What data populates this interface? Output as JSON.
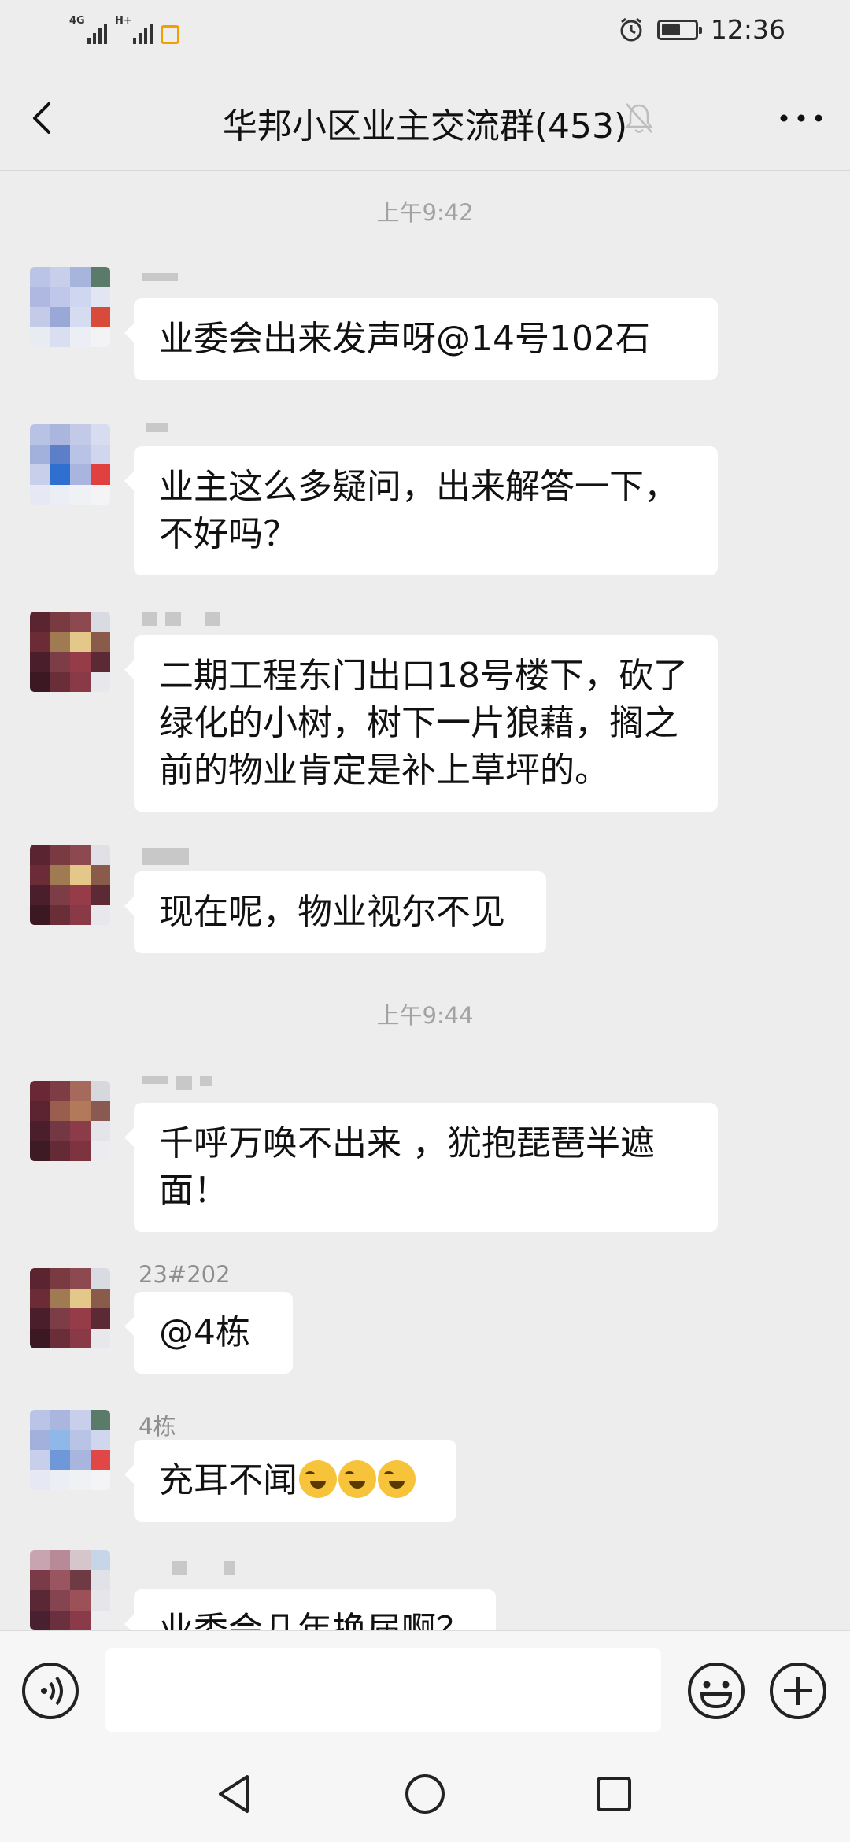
{
  "status_bar": {
    "network_1": "4G",
    "network_2": "H+",
    "time": "12:36"
  },
  "header": {
    "title": "华邦小区业主交流群(453)",
    "back_icon": "chevron-left-icon",
    "mute_icon": "bell-off-icon",
    "more_icon": "more-icon"
  },
  "chat": {
    "timestamps": [
      "上午9:42",
      "上午9:44"
    ],
    "messages": [
      {
        "sender": "",
        "text": "业委会出来发声呀@14号102石"
      },
      {
        "sender": "",
        "text": "业主这么多疑问，出来解答一下，不好吗？"
      },
      {
        "sender": "",
        "text": "二期工程东门出口18号楼下，砍了绿化的小树，树下一片狼藉，搁之前的物业肯定是补上草坪的。"
      },
      {
        "sender": "",
        "text": "现在呢，物业视尔不见"
      },
      {
        "sender": "",
        "text": "千呼万唤不出来 ，犹抱琵琶半遮面！"
      },
      {
        "sender": "23#202",
        "text": "@4栋"
      },
      {
        "sender": "4栋",
        "text": "充耳不闻"
      },
      {
        "sender": "",
        "text": "业委会几年换届啊？"
      }
    ]
  },
  "input_bar": {
    "voice_icon": "voice-icon",
    "emoji_icon": "emoji-icon",
    "plus_icon": "plus-icon",
    "placeholder": ""
  },
  "nav_bar": {
    "back_icon": "triangle-back-icon",
    "home_icon": "circle-home-icon",
    "recent_icon": "square-recent-icon"
  },
  "colors": {
    "background": "#ededed",
    "bubble": "#ffffff",
    "timestamp": "#a3a3a3"
  }
}
